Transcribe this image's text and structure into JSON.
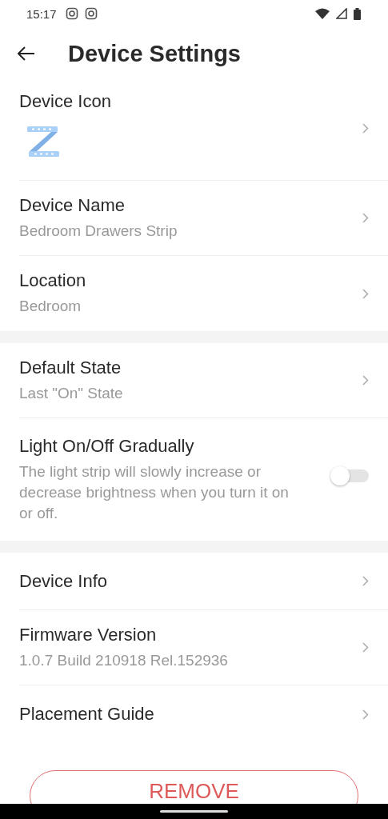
{
  "status_bar": {
    "time": "15:17"
  },
  "header": {
    "title": "Device Settings"
  },
  "sections": [
    {
      "items": [
        {
          "kind": "icon",
          "title": "Device Icon"
        },
        {
          "kind": "nav",
          "title": "Device Name",
          "subtitle": "Bedroom Drawers Strip"
        },
        {
          "kind": "nav",
          "title": "Location",
          "subtitle": "Bedroom"
        }
      ]
    },
    {
      "items": [
        {
          "kind": "nav",
          "title": "Default State",
          "subtitle": "Last \"On\" State"
        },
        {
          "kind": "toggle",
          "title": "Light On/Off Gradually",
          "subtitle": "The light strip will slowly increase or decrease brightness when you turn it on or off.",
          "on": false
        }
      ]
    },
    {
      "items": [
        {
          "kind": "nav",
          "title": "Device Info"
        },
        {
          "kind": "nav",
          "title": "Firmware Version",
          "subtitle": "1.0.7 Build 210918 Rel.152936"
        },
        {
          "kind": "nav",
          "title": "Placement Guide"
        }
      ]
    }
  ],
  "remove_button": {
    "label": "REMOVE"
  }
}
